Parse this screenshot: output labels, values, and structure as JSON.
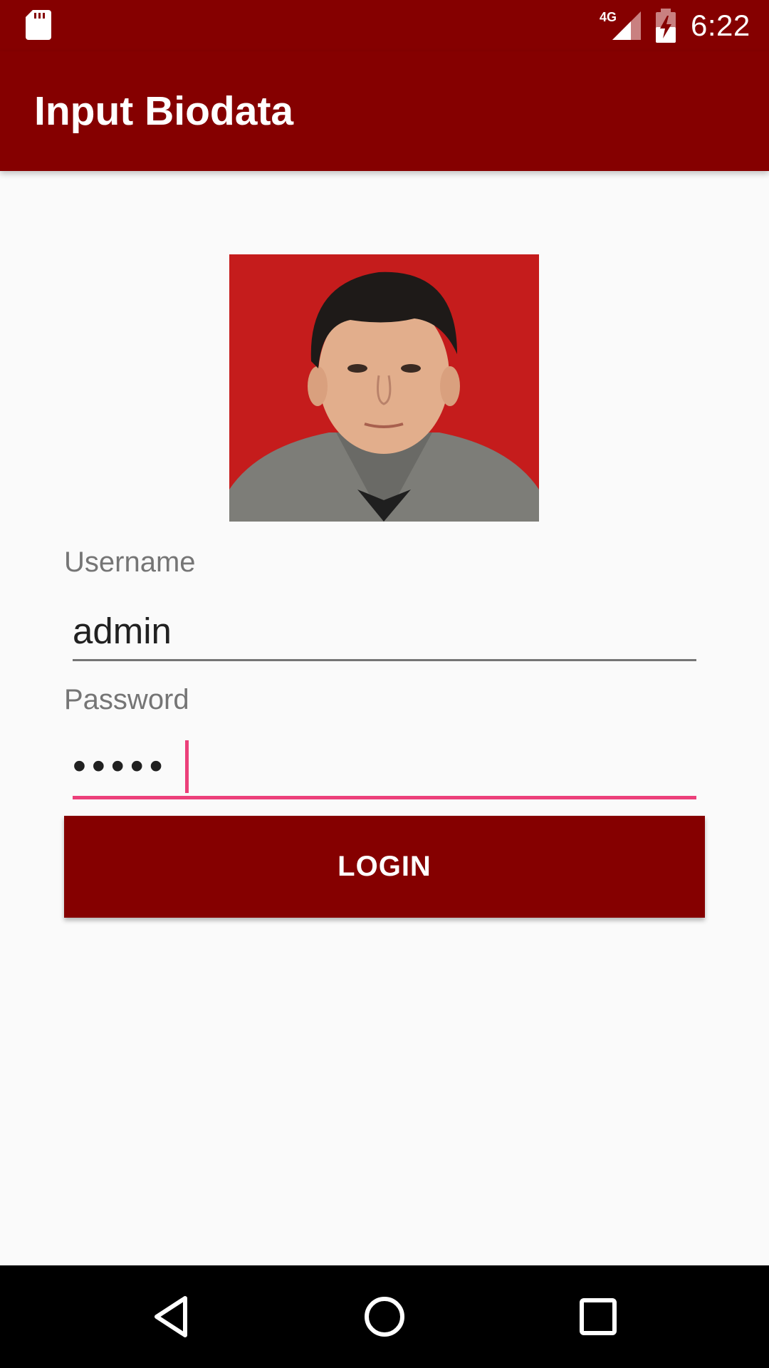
{
  "status_bar": {
    "time": "6:22",
    "network_label": "4G",
    "icons": [
      "sd-card-icon",
      "signal-4g-icon",
      "battery-charging-icon"
    ]
  },
  "app_bar": {
    "title": "Input Biodata"
  },
  "profile": {
    "photo_icon": "profile-photo"
  },
  "form": {
    "username_label": "Username",
    "username_value": "admin",
    "password_label": "Password",
    "password_masked": "•••••",
    "login_label": "LOGIN"
  },
  "nav_bar": {
    "icons": [
      "back-icon",
      "home-icon",
      "recents-icon"
    ]
  },
  "colors": {
    "primary": "#850000",
    "accent": "#ec407a",
    "background": "#fafafa",
    "label_gray": "#757575"
  }
}
